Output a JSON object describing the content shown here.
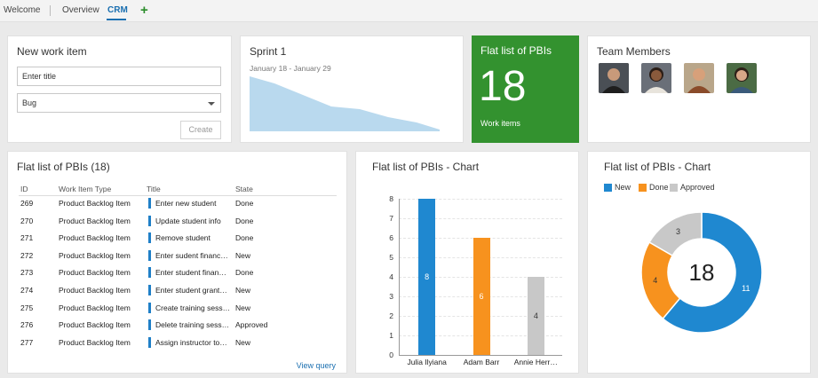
{
  "tabs": {
    "welcome": "Welcome",
    "overview": "Overview",
    "crm": "CRM",
    "add": "+"
  },
  "new_work_item": {
    "title": "New work item",
    "title_placeholder": "Enter title",
    "type_value": "Bug",
    "create_label": "Create"
  },
  "sprint": {
    "title": "Sprint 1",
    "dates": "January 18 - January 29",
    "burndown_fill": "#b9d9ee"
  },
  "pbi_tile": {
    "title": "Flat list of PBIs",
    "count": "18",
    "caption": "Work items",
    "color": "#33922f"
  },
  "team": {
    "title": "Team Members",
    "members": [
      "member-1",
      "member-2",
      "member-3",
      "member-4"
    ]
  },
  "pbi_list": {
    "title": "Flat list of PBIs (18)",
    "columns": [
      "ID",
      "Work Item Type",
      "Title",
      "State"
    ],
    "rows": [
      [
        "269",
        "Product Backlog Item",
        "Enter new student",
        "Done"
      ],
      [
        "270",
        "Product Backlog Item",
        "Update student info",
        "Done"
      ],
      [
        "271",
        "Product Backlog Item",
        "Remove student",
        "Done"
      ],
      [
        "272",
        "Product Backlog Item",
        "Enter sudent financ…",
        "New"
      ],
      [
        "273",
        "Product Backlog Item",
        "Enter student finan…",
        "Done"
      ],
      [
        "274",
        "Product Backlog Item",
        "Enter student grant…",
        "New"
      ],
      [
        "275",
        "Product Backlog Item",
        "Create training sess…",
        "New"
      ],
      [
        "276",
        "Product Backlog Item",
        "Delete training sess…",
        "Approved"
      ],
      [
        "277",
        "Product Backlog Item",
        "Assign instructor to…",
        "New"
      ]
    ],
    "view_query": "View query",
    "accent": "#1f7fc7"
  },
  "bar_chart_card": {
    "title": "Flat list of PBIs - Chart"
  },
  "donut_card": {
    "title": "Flat list of PBIs - Chart",
    "center_total": "18"
  },
  "chart_data": [
    {
      "type": "bar",
      "title": "Flat list of PBIs - Chart",
      "categories": [
        "Julia Ilyiana",
        "Adam Barr",
        "Annie Herr…"
      ],
      "values": [
        8,
        6,
        4
      ],
      "colors": [
        "#1f88d0",
        "#f7921e",
        "#c8c8c8"
      ],
      "ylim": [
        0,
        8
      ],
      "yticks": [
        "0",
        "1",
        "2",
        "3",
        "4",
        "5",
        "6",
        "7",
        "8"
      ],
      "grid": true,
      "xlabel": "",
      "ylabel": ""
    },
    {
      "type": "pie",
      "title": "Flat list of PBIs - Chart",
      "categories": [
        "New",
        "Done",
        "Approved"
      ],
      "values": [
        11,
        4,
        3
      ],
      "colors": [
        "#1f88d0",
        "#f7921e",
        "#c8c8c8"
      ],
      "legend": "top-left"
    }
  ]
}
